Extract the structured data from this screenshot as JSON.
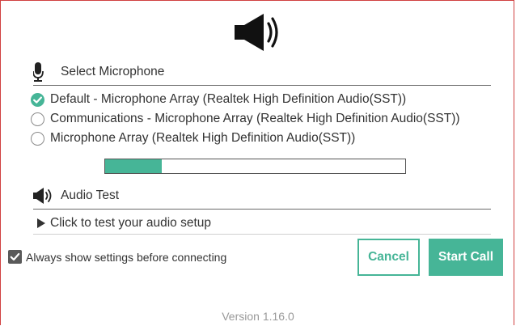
{
  "colors": {
    "accent": "#46b597",
    "text": "#333333",
    "muted": "#999999",
    "frame_border": "#d04040"
  },
  "header": {
    "icon": "speaker-icon"
  },
  "microphone": {
    "title": "Select Microphone",
    "icon": "microphone-icon",
    "options": [
      {
        "label": "Default - Microphone Array (Realtek High Definition Audio(SST))",
        "selected": true
      },
      {
        "label": "Communications - Microphone Array (Realtek High Definition Audio(SST))",
        "selected": false
      },
      {
        "label": "Microphone Array (Realtek High Definition Audio(SST))",
        "selected": false
      }
    ],
    "input_level_percent": 19
  },
  "audio_test": {
    "title": "Audio Test",
    "icon": "speaker-icon",
    "link_label": "Click to test your audio setup"
  },
  "settings": {
    "always_show_label": "Always show settings before connecting",
    "always_show_checked": true
  },
  "buttons": {
    "cancel_label": "Cancel",
    "start_label": "Start Call"
  },
  "footer": {
    "version": "Version 1.16.0"
  }
}
